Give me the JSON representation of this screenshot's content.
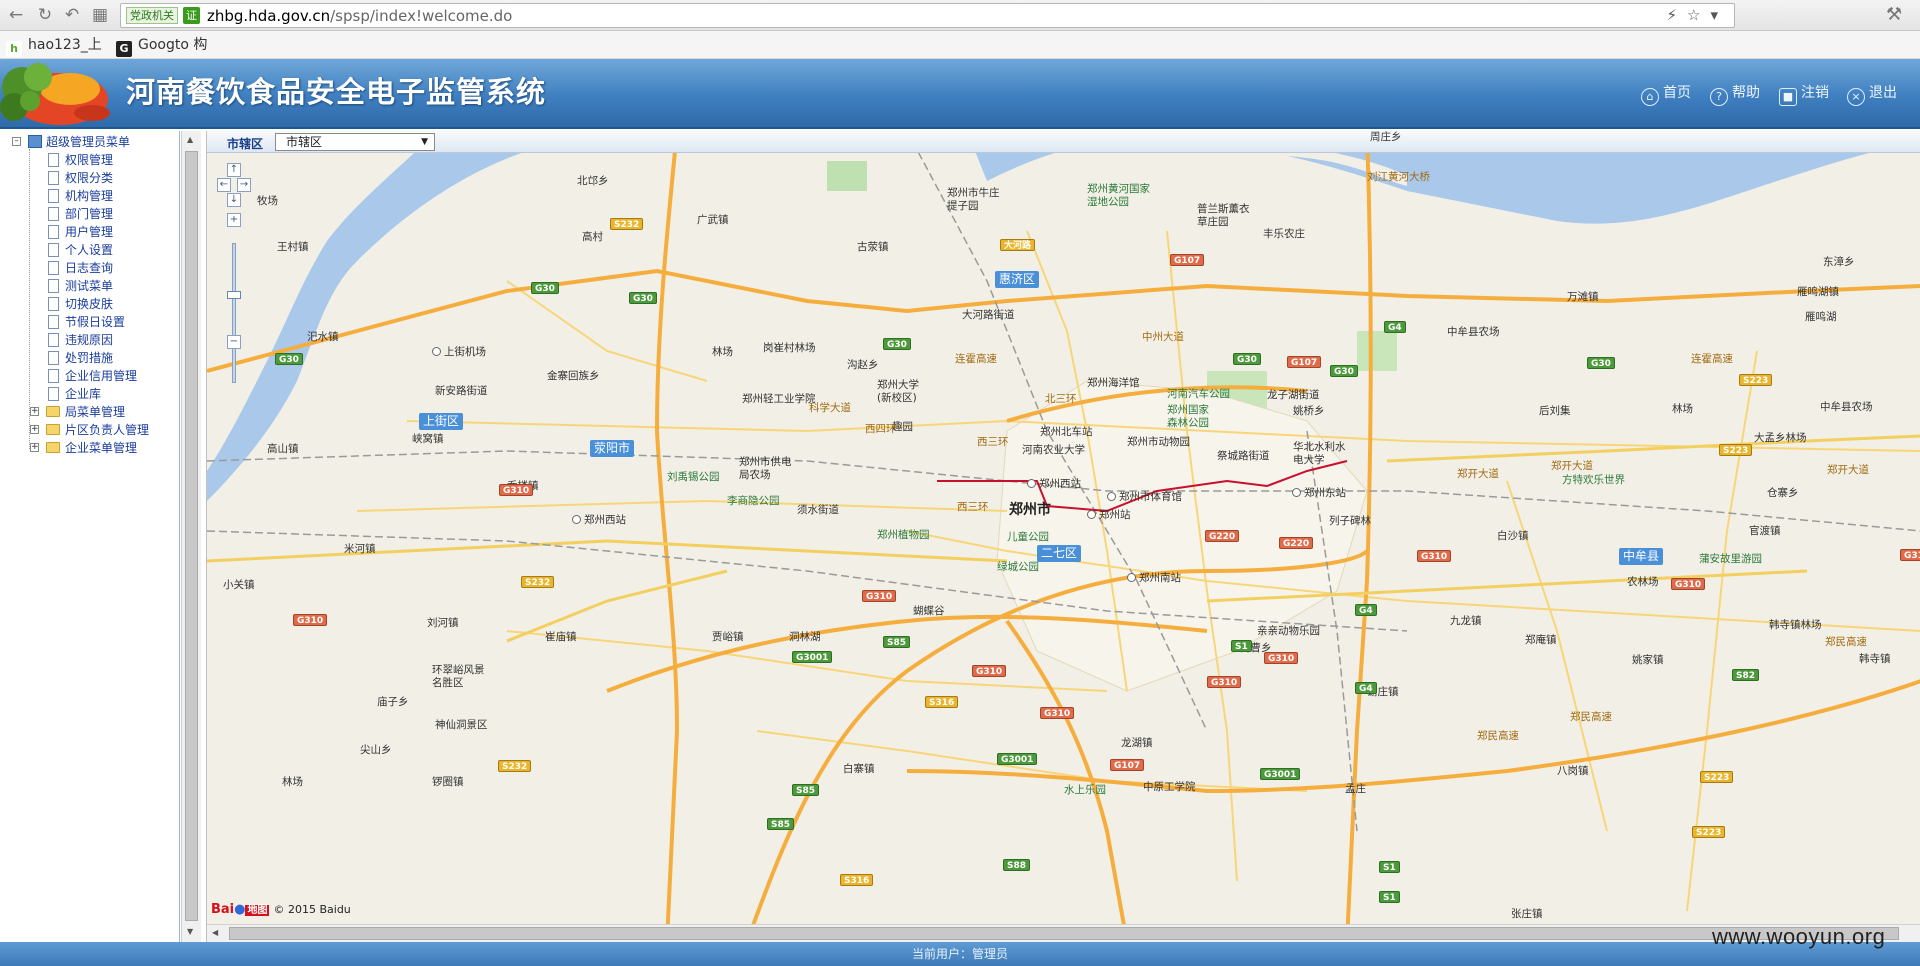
{
  "browser": {
    "badge_gov": "党政机关",
    "badge_ev": "证",
    "url_host": "zhbg.hda.gov.cn",
    "url_path": "/spsp/index!welcome.do",
    "bookmarks": [
      "hao123_上",
      "Googto 构"
    ]
  },
  "header": {
    "title": "河南餐饮食品安全电子监管系统",
    "nav": [
      {
        "label": "首页",
        "icon": "home-icon"
      },
      {
        "label": "帮助",
        "icon": "help-icon"
      },
      {
        "label": "注销",
        "icon": "lock-icon"
      },
      {
        "label": "退出",
        "icon": "exit-icon"
      }
    ]
  },
  "sidebar": {
    "root": "超级管理员菜单",
    "items": [
      "权限管理",
      "权限分类",
      "机构管理",
      "部门管理",
      "用户管理",
      "个人设置",
      "日志查询",
      "测试菜单",
      "切换皮肤",
      "节假日设置",
      "违规原因",
      "处罚措施",
      "企业信用管理",
      "企业库"
    ],
    "folders": [
      "局菜单管理",
      "片区负责人管理",
      "企业菜单管理"
    ]
  },
  "map": {
    "district_label": "市辖区",
    "district_value": "市辖区",
    "copyright": "© 2015 Baidu",
    "baidu_logo_text": "Bai",
    "baidu_logo_text2": "地图",
    "labels": {
      "l1": "北邙乡",
      "l2": "牧场",
      "l3": "广武镇",
      "l4": "高村",
      "l5": "王村镇",
      "l6": "古荥镇",
      "l7": "郑州市牛庄提子园",
      "l8": "郑州黄河国家湿地公园",
      "l9": "普兰斯薰衣草庄园",
      "l10": "丰乐农庄",
      "l11": "大河路",
      "l12": "惠济区",
      "l13": "大河路街道",
      "l14": "汜水镇",
      "l15": "上街机场",
      "l16": "林场",
      "l17": "岗崔村林场",
      "l18": "沟赵乡",
      "l19": "金寨回族乡",
      "l20": "新安路街道",
      "l21": "郑州轻工业学院",
      "l22": "郑州大学(新校区)",
      "l23": "郑州海洋馆",
      "l24": "河南汽车公园",
      "l25": "郑州国家森林公园",
      "l26": "龙子湖街道",
      "l27": "姚桥乡",
      "l28": "上街区",
      "l29": "峡窝镇",
      "l30": "荥阳市",
      "l31": "趣园",
      "l32": "郑州北车站",
      "l33": "河南农业大学",
      "l34": "郑州市动物园",
      "l35": "祭城路街道",
      "l36": "华北水利水电大学",
      "l37": "高山镇",
      "l38": "刘禹锡公园",
      "l39": "郑州市供电局农场",
      "l40": "乔楼镇",
      "l41": "李商隐公园",
      "l42": "郑州西站",
      "l43": "郑州西站",
      "l44": "郑州市体育馆",
      "l45": "郑州东站",
      "l46": "须水街道",
      "l47": "郑州市",
      "l48": "郑州站",
      "l49": "郑州植物园",
      "l50": "儿童公园",
      "l51": "二七区",
      "l52": "绿城公园",
      "l53": "郑州南站",
      "l54": "列子碑林",
      "l55": "米河镇",
      "l56": "小关镇",
      "l57": "刘河镇",
      "l58": "崔庙镇",
      "l59": "贾峪镇",
      "l60": "洞林湖",
      "l61": "蝴蝶谷",
      "l62": "九龙镇",
      "l63": "亲亲动物乐园",
      "l64": "南曹乡",
      "l65": "环翠峪风景名胜区",
      "l66": "庙子乡",
      "l67": "神仙洞景区",
      "l68": "尖山乡",
      "l69": "林场",
      "l70": "锣圈镇",
      "l71": "白寨镇",
      "l72": "水上乐园",
      "l73": "中原工学院",
      "l74": "龙湖镇",
      "l75": "孟庄",
      "l76": "谢庄镇",
      "l77": "郑庵镇",
      "l78": "姚家镇",
      "l79": "韩寺镇林场",
      "l80": "韩寺镇",
      "l81": "八岗镇",
      "l82": "张庄镇",
      "l83": "中牟县",
      "l84": "官渡镇",
      "l85": "仓寨乡",
      "l86": "蒲安故里游园",
      "l87": "农林场",
      "l88": "白沙镇",
      "l89": "方特欢乐世界",
      "l90": "大孟乡林场",
      "l91": "林场",
      "l92": "后刘集",
      "l93": "中牟县农场",
      "l94": "万滩镇",
      "l95": "雁鸣湖镇",
      "l96": "雁鸣湖",
      "l97": "东漳乡",
      "l98": "中牟县农场",
      "l99": "中牟县农场",
      "l100": "周庄乡",
      "l101": "连霍高速",
      "l102": "连霍高速",
      "l103": "郑开大道",
      "l104": "郑开大道",
      "l105": "郑民高速",
      "l106": "郑民高速",
      "l107": "郑民高速",
      "l108": "郑开大道",
      "l109": "科学大道",
      "l110": "北三环",
      "l111": "西四环",
      "l112": "西三环",
      "l113": "西三环",
      "l114": "中州大道",
      "l115": "刘江黄河大桥",
      "l116": "郑开大道"
    },
    "shields": {
      "s1": "G30",
      "s2": "G30",
      "s3": "G30",
      "s4": "G30",
      "s5": "G30",
      "s6": "G30",
      "s7": "G30",
      "s8": "G107",
      "s9": "G107",
      "s10": "G107",
      "s11": "G4",
      "s12": "G4",
      "s13": "G4",
      "s14": "G310",
      "s15": "G310",
      "s16": "G310",
      "s17": "G310",
      "s18": "G310",
      "s19": "G310",
      "s20": "G310",
      "s21": "G310",
      "s22": "G310",
      "s23": "S232",
      "s24": "S232",
      "s25": "S232",
      "s26": "G220",
      "s27": "G220",
      "s28": "S85",
      "s29": "S85",
      "s30": "S85",
      "s31": "G3001",
      "s32": "G3001",
      "s33": "G3001",
      "s34": "S316",
      "s35": "S316",
      "s36": "S88",
      "s37": "S1",
      "s38": "S1",
      "s39": "S1",
      "s40": "S223",
      "s41": "S223",
      "s42": "S223",
      "s43": "S223",
      "s44": "S82",
      "s45": "G310"
    }
  },
  "footer": {
    "user_text": "当前用户：管理员"
  },
  "watermark": "www.wooyun.org"
}
